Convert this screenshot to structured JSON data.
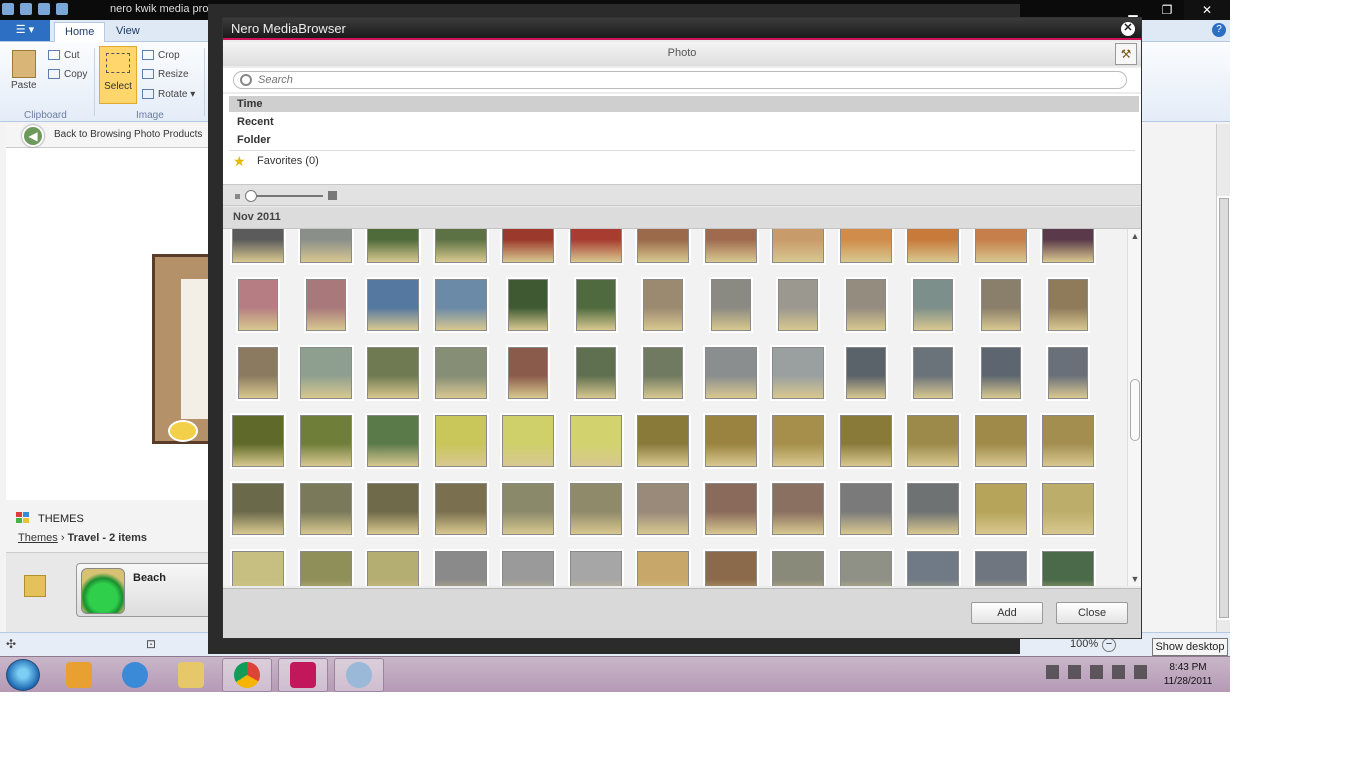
{
  "app": {
    "window_title": "nero kwik media proc",
    "tabs": [
      "Home",
      "View"
    ],
    "ribbon": {
      "paste": "Paste",
      "cut": "Cut",
      "copy": "Copy",
      "select": "Select",
      "crop": "Crop",
      "resize": "Resize",
      "rotate": "Rotate",
      "groups": [
        "Clipboard",
        "Image"
      ]
    },
    "back_link": "Back to Browsing Photo Products",
    "themes_label": "THEMES",
    "breadcrumb": {
      "root": "Themes",
      "sep": "›",
      "current": "Travel - 2 items"
    },
    "theme_tile": "Beach",
    "zoom": "100%",
    "show_desktop": "Show desktop"
  },
  "dialog": {
    "title": "Nero MediaBrowser",
    "header": "Photo",
    "search_placeholder": "Search",
    "nav": [
      "Time",
      "Recent",
      "Folder"
    ],
    "favorites": "Favorites (0)",
    "month": "Nov 2011",
    "buttons": {
      "add": "Add",
      "close": "Close"
    }
  },
  "photos": {
    "columns": 13,
    "rows": [
      [
        "#5b5b5b",
        "#8a8f8a",
        "#4f6b3a",
        "#5d7244",
        "#9b3a2c",
        "#a83c30",
        "#9a6a4a",
        "#a06a4e",
        "#c89b6a",
        "#cf8c4a",
        "#c77a3a",
        "#c67f4a",
        "#5a3a4a"
      ],
      [
        "#b67e82",
        "#a8787a",
        "#5478a0",
        "#6a8aa8",
        "#3f5a33",
        "#4e6a3e",
        "#9c8a70",
        "#8b8a82",
        "#9b9890",
        "#958c80",
        "#7d8f8a",
        "#8a7f6a",
        "#8f7a5a"
      ],
      [
        "#8c7a60",
        "#8f9f8f",
        "#6f7a52",
        "#868e76",
        "#8a5a4a",
        "#5f7050",
        "#6f7a60",
        "#8a8e8e",
        "#9aa0a0",
        "#5a626a",
        "#6a727a",
        "#5d6670",
        "#6a707a"
      ],
      [
        "#5f6a2a",
        "#6f7f3a",
        "#5a7a4a",
        "#c9c65a",
        "#cfd06a",
        "#d2d36e",
        "#8a7a3a",
        "#9a8340",
        "#a58f4a",
        "#8a7a3a",
        "#9c8a4a",
        "#a08a4a",
        "#a38e50"
      ],
      [
        "#6a6a4a",
        "#7a7a5a",
        "#6f6a4a",
        "#7a7050",
        "#8a8a6a",
        "#8f8a6a",
        "#9a8a7a",
        "#8a6a5a",
        "#8a7060",
        "#7a7a7a",
        "#6f7272",
        "#b6a45a",
        "#bcae6a"
      ],
      [
        "#c7bf82",
        "#8f8f5a",
        "#b5ae72",
        "#8a8a8a",
        "#9a9a9a",
        "#a6a6a6",
        "#c8a86a",
        "#8a6a4a",
        "#8a8a7a",
        "#8f9086",
        "#6f7a86",
        "#6f7680",
        "#4a6a4a"
      ]
    ]
  }
}
